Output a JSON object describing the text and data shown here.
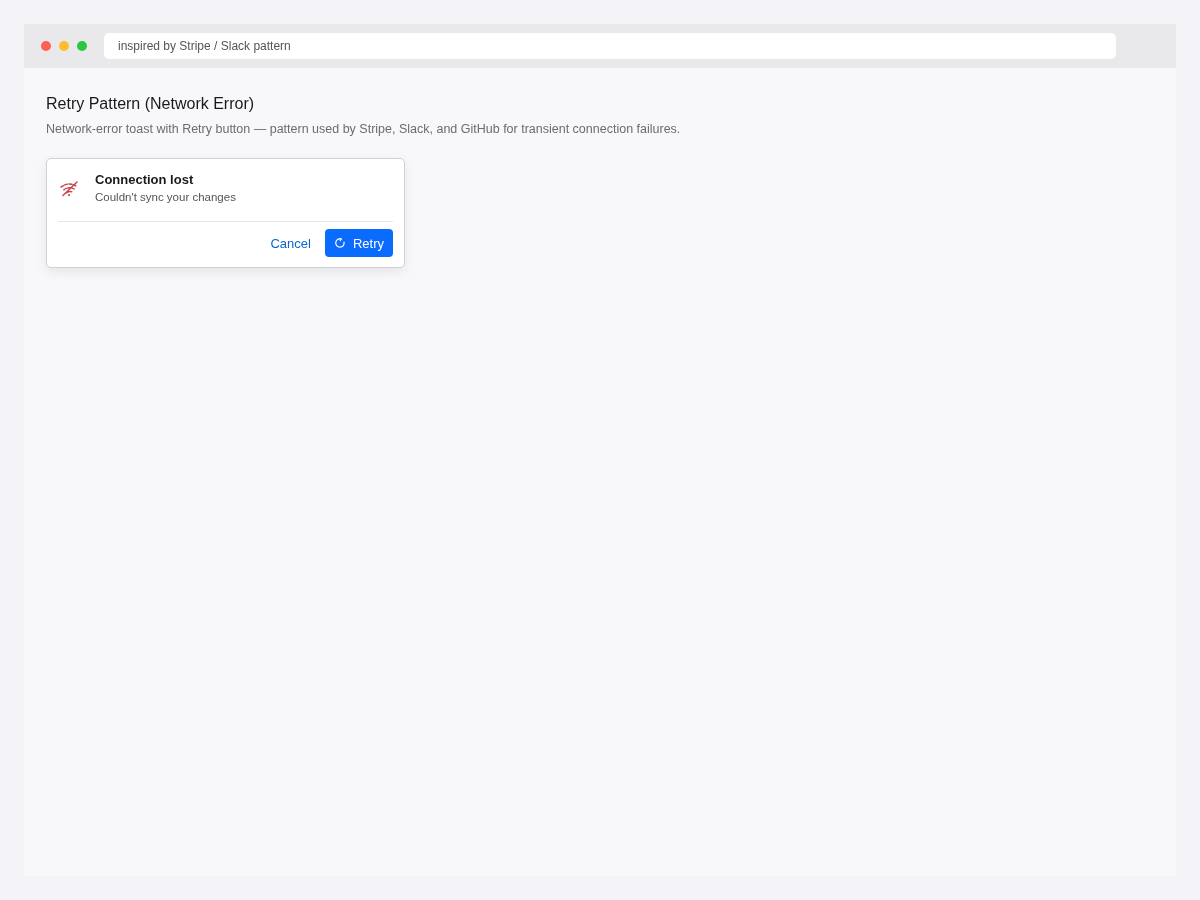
{
  "window": {
    "address": "inspired by Stripe / Slack pattern"
  },
  "page": {
    "title": "Retry Pattern (Network Error)",
    "description": "Network-error toast with Retry button — pattern used by Stripe, Slack, and GitHub for transient connection failures."
  },
  "toast": {
    "title": "Connection lost",
    "message": "Couldn't sync your changes",
    "actions": [
      {
        "label": "Cancel",
        "kind": "link"
      },
      {
        "label": "Retry",
        "kind": "primary"
      }
    ]
  }
}
